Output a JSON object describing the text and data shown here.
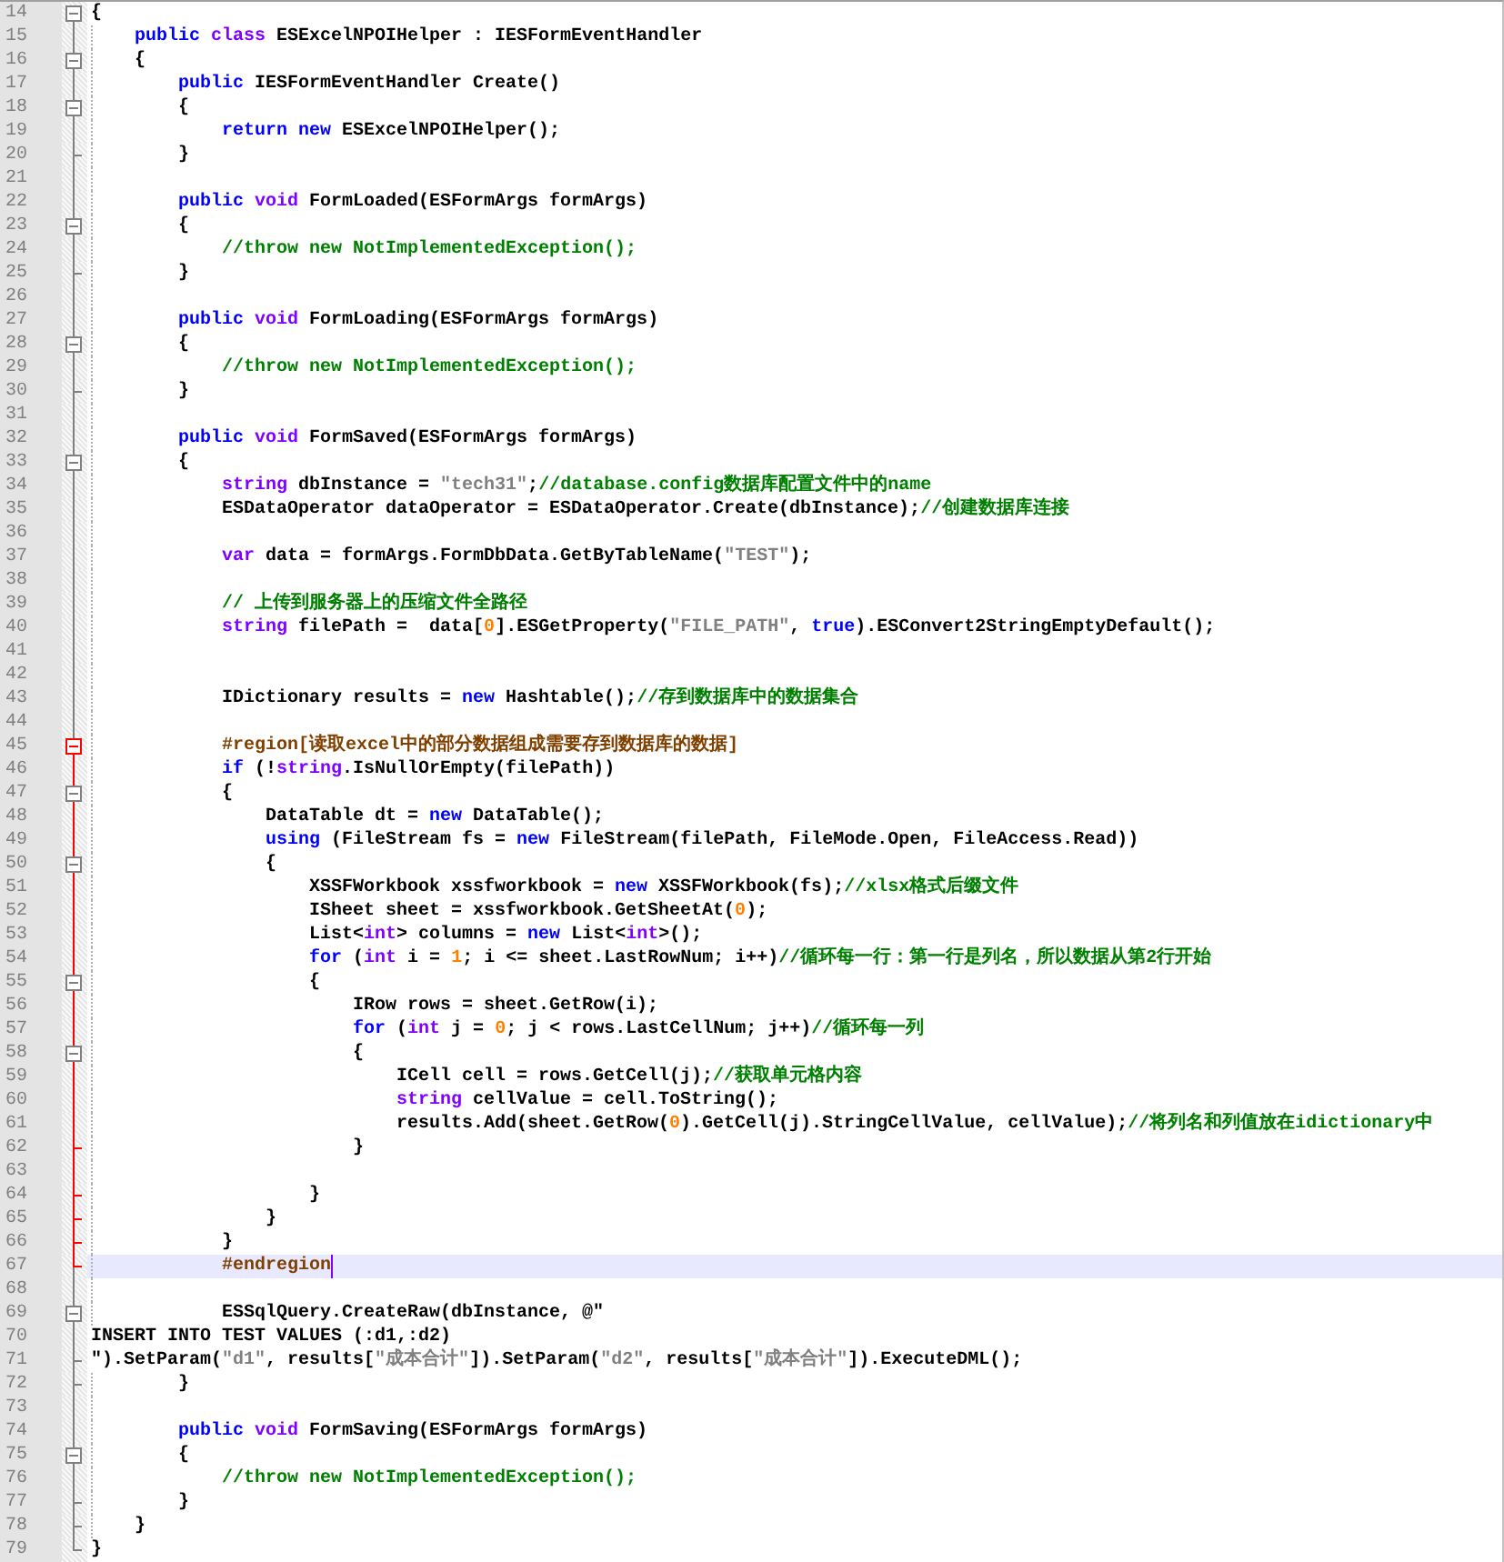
{
  "lines": [
    {
      "number": "14",
      "kind": "code",
      "fold_start": true,
      "fold_end": false,
      "region": false,
      "current": false,
      "segments": [
        {
          "kind": "plain",
          "text": "{"
        }
      ]
    },
    {
      "number": "15",
      "kind": "code",
      "fold_start": false,
      "fold_end": false,
      "region": false,
      "current": false,
      "segments": [
        {
          "kind": "keyword",
          "text": "public "
        },
        {
          "kind": "type",
          "text": "class"
        },
        {
          "kind": "plain",
          "text": " ESExcelNPOIHelper : IESFormEventHandler"
        }
      ]
    },
    {
      "number": "16",
      "kind": "code",
      "fold_start": true,
      "fold_end": false,
      "region": false,
      "current": false,
      "segments": [
        {
          "kind": "plain",
          "text": "{"
        }
      ]
    },
    {
      "number": "17",
      "kind": "code",
      "fold_start": false,
      "fold_end": false,
      "region": false,
      "current": false,
      "segments": [
        {
          "kind": "keyword",
          "text": "public"
        },
        {
          "kind": "plain",
          "text": " IESFormEventHandler Create()"
        }
      ]
    },
    {
      "number": "18",
      "kind": "code",
      "fold_start": true,
      "fold_end": false,
      "region": false,
      "current": false,
      "segments": [
        {
          "kind": "plain",
          "text": "{"
        }
      ]
    },
    {
      "number": "19",
      "kind": "code",
      "fold_start": false,
      "fold_end": false,
      "region": false,
      "current": false,
      "segments": [
        {
          "kind": "keyword",
          "text": "return new"
        },
        {
          "kind": "plain",
          "text": " ESExcelNPOIHelper();"
        }
      ]
    },
    {
      "number": "20",
      "kind": "code",
      "fold_start": false,
      "fold_end": true,
      "region": false,
      "current": false,
      "segments": [
        {
          "kind": "plain",
          "text": "}"
        }
      ]
    },
    {
      "number": "21",
      "kind": "code",
      "fold_start": false,
      "fold_end": false,
      "region": false,
      "current": false
    },
    {
      "number": "22",
      "kind": "code",
      "fold_start": false,
      "fold_end": false,
      "region": false,
      "current": false,
      "segments": [
        {
          "kind": "keyword",
          "text": "public "
        },
        {
          "kind": "type",
          "text": "void"
        },
        {
          "kind": "plain",
          "text": " FormLoaded(ESFormArgs formArgs)"
        }
      ]
    },
    {
      "number": "23",
      "kind": "code",
      "fold_start": true,
      "fold_end": false,
      "region": false,
      "current": false,
      "segments": [
        {
          "kind": "plain",
          "text": "{"
        }
      ]
    },
    {
      "number": "24",
      "kind": "code",
      "fold_start": false,
      "fold_end": false,
      "region": false,
      "current": false,
      "segments": [
        {
          "kind": "comment",
          "text": "//throw new NotImplementedException();"
        }
      ]
    },
    {
      "number": "25",
      "kind": "code",
      "fold_start": false,
      "fold_end": true,
      "region": false,
      "current": false,
      "segments": [
        {
          "kind": "plain",
          "text": "}"
        }
      ]
    },
    {
      "number": "26",
      "kind": "code",
      "fold_start": false,
      "fold_end": false,
      "region": false,
      "current": false
    },
    {
      "number": "27",
      "kind": "code",
      "fold_start": false,
      "fold_end": false,
      "region": false,
      "current": false,
      "segments": [
        {
          "kind": "keyword",
          "text": "public "
        },
        {
          "kind": "type",
          "text": "void"
        },
        {
          "kind": "plain",
          "text": " FormLoading(ESFormArgs formArgs)"
        }
      ]
    },
    {
      "number": "28",
      "kind": "code",
      "fold_start": true,
      "fold_end": false,
      "region": false,
      "current": false,
      "segments": [
        {
          "kind": "plain",
          "text": "{"
        }
      ]
    },
    {
      "number": "29",
      "kind": "code",
      "fold_start": false,
      "fold_end": false,
      "region": false,
      "current": false,
      "segments": [
        {
          "kind": "comment",
          "text": "//throw new NotImplementedException();"
        }
      ]
    },
    {
      "number": "30",
      "kind": "code",
      "fold_start": false,
      "fold_end": true,
      "region": false,
      "current": false,
      "segments": [
        {
          "kind": "plain",
          "text": "}"
        }
      ]
    },
    {
      "number": "31",
      "kind": "code",
      "fold_start": false,
      "fold_end": false,
      "region": false,
      "current": false
    },
    {
      "number": "32",
      "kind": "code",
      "fold_start": false,
      "fold_end": false,
      "region": false,
      "current": false,
      "segments": [
        {
          "kind": "keyword",
          "text": "public "
        },
        {
          "kind": "type",
          "text": "void"
        },
        {
          "kind": "plain",
          "text": " FormSaved(ESFormArgs formArgs)"
        }
      ]
    },
    {
      "number": "33",
      "kind": "code",
      "fold_start": true,
      "fold_end": false,
      "region": false,
      "current": false,
      "segments": [
        {
          "kind": "plain",
          "text": "{"
        }
      ]
    },
    {
      "number": "34",
      "kind": "code",
      "fold_start": false,
      "fold_end": false,
      "region": false,
      "current": false,
      "segments": [
        {
          "kind": "type",
          "text": "string"
        },
        {
          "kind": "plain",
          "text": " dbInstance = "
        },
        {
          "kind": "string",
          "text": "\"tech31\""
        },
        {
          "kind": "plain",
          "text": ";"
        },
        {
          "kind": "comment",
          "text": "//database.config数据库配置文件中的name"
        }
      ]
    },
    {
      "number": "35",
      "kind": "code",
      "fold_start": false,
      "fold_end": false,
      "region": false,
      "current": false,
      "segments": [
        {
          "kind": "plain",
          "text": "ESDataOperator dataOperator = ESDataOperator.Create(dbInstance);"
        },
        {
          "kind": "comment",
          "text": "//创建数据库连接"
        }
      ]
    },
    {
      "number": "36",
      "kind": "code",
      "fold_start": false,
      "fold_end": false,
      "region": false,
      "current": false
    },
    {
      "number": "37",
      "kind": "code",
      "fold_start": false,
      "fold_end": false,
      "region": false,
      "current": false,
      "segments": [
        {
          "kind": "type",
          "text": "var"
        },
        {
          "kind": "plain",
          "text": " data = formArgs.FormDbData.GetByTableName("
        },
        {
          "kind": "string",
          "text": "\"TEST\""
        },
        {
          "kind": "plain",
          "text": ");"
        }
      ]
    },
    {
      "number": "38",
      "kind": "code",
      "fold_start": false,
      "fold_end": false,
      "region": false,
      "current": false
    },
    {
      "number": "39",
      "kind": "code",
      "fold_start": false,
      "fold_end": false,
      "region": false,
      "current": false,
      "segments": [
        {
          "kind": "comment",
          "text": "// 上传到服务器上的压缩文件全路径"
        }
      ]
    },
    {
      "number": "40",
      "kind": "code",
      "fold_start": false,
      "fold_end": false,
      "region": false,
      "current": false,
      "segments": [
        {
          "kind": "type",
          "text": "string"
        },
        {
          "kind": "plain",
          "text": " filePath =  data["
        },
        {
          "kind": "number",
          "text": "0"
        },
        {
          "kind": "plain",
          "text": "].ESGetProperty("
        },
        {
          "kind": "string",
          "text": "\"FILE_PATH\""
        },
        {
          "kind": "plain",
          "text": ", "
        },
        {
          "kind": "keyword",
          "text": "true"
        },
        {
          "kind": "plain",
          "text": ").ESConvert2StringEmptyDefault();"
        }
      ]
    },
    {
      "number": "41",
      "kind": "code",
      "fold_start": false,
      "fold_end": false,
      "region": false,
      "current": false
    },
    {
      "number": "42",
      "kind": "code",
      "fold_start": false,
      "fold_end": false,
      "region": false,
      "current": false
    },
    {
      "number": "43",
      "kind": "code",
      "fold_start": false,
      "fold_end": false,
      "region": false,
      "current": false,
      "segments": [
        {
          "kind": "plain",
          "text": "IDictionary results = "
        },
        {
          "kind": "keyword",
          "text": "new"
        },
        {
          "kind": "plain",
          "text": " Hashtable();"
        },
        {
          "kind": "comment",
          "text": "//存到数据库中的数据集合"
        }
      ]
    },
    {
      "number": "44",
      "kind": "code",
      "fold_start": false,
      "fold_end": false,
      "region": false,
      "current": false
    },
    {
      "number": "45",
      "kind": "code",
      "fold_start": true,
      "fold_end": false,
      "region": true,
      "current": false,
      "segments": [
        {
          "kind": "preprocessor",
          "text": "#region[读取excel中的部分数据组成需要存到数据库的数据]"
        }
      ]
    },
    {
      "number": "46",
      "kind": "code",
      "fold_start": false,
      "fold_end": false,
      "region": true,
      "current": false,
      "segments": [
        {
          "kind": "keyword",
          "text": "if"
        },
        {
          "kind": "plain",
          "text": " (!"
        },
        {
          "kind": "type",
          "text": "string"
        },
        {
          "kind": "plain",
          "text": ".IsNullOrEmpty(filePath))"
        }
      ]
    },
    {
      "number": "47",
      "kind": "code",
      "fold_start": true,
      "fold_end": false,
      "region": true,
      "current": false,
      "segments": [
        {
          "kind": "plain",
          "text": "{"
        }
      ]
    },
    {
      "number": "48",
      "kind": "code",
      "fold_start": false,
      "fold_end": false,
      "region": true,
      "current": false,
      "segments": [
        {
          "kind": "plain",
          "text": "DataTable dt = "
        },
        {
          "kind": "keyword",
          "text": "new"
        },
        {
          "kind": "plain",
          "text": " DataTable();"
        }
      ]
    },
    {
      "number": "49",
      "kind": "code",
      "fold_start": false,
      "fold_end": false,
      "region": true,
      "current": false,
      "segments": [
        {
          "kind": "keyword",
          "text": "using"
        },
        {
          "kind": "plain",
          "text": " (FileStream fs = "
        },
        {
          "kind": "keyword",
          "text": "new"
        },
        {
          "kind": "plain",
          "text": " FileStream(filePath, FileMode.Open, FileAccess.Read))"
        }
      ]
    },
    {
      "number": "50",
      "kind": "code",
      "fold_start": true,
      "fold_end": false,
      "region": true,
      "current": false,
      "segments": [
        {
          "kind": "plain",
          "text": "{"
        }
      ]
    },
    {
      "number": "51",
      "kind": "code",
      "fold_start": false,
      "fold_end": false,
      "region": true,
      "current": false,
      "segments": [
        {
          "kind": "plain",
          "text": "XSSFWorkbook xssfworkbook = "
        },
        {
          "kind": "keyword",
          "text": "new"
        },
        {
          "kind": "plain",
          "text": " XSSFWorkbook(fs);"
        },
        {
          "kind": "comment",
          "text": "//xlsx格式后缀文件"
        }
      ]
    },
    {
      "number": "52",
      "kind": "code",
      "fold_start": false,
      "fold_end": false,
      "region": true,
      "current": false,
      "segments": [
        {
          "kind": "plain",
          "text": "ISheet sheet = xssfworkbook.GetSheetAt("
        },
        {
          "kind": "number",
          "text": "0"
        },
        {
          "kind": "plain",
          "text": ");"
        }
      ]
    },
    {
      "number": "53",
      "kind": "code",
      "fold_start": false,
      "fold_end": false,
      "region": true,
      "current": false,
      "segments": [
        {
          "kind": "plain",
          "text": "List<"
        },
        {
          "kind": "type",
          "text": "int"
        },
        {
          "kind": "plain",
          "text": "> columns = "
        },
        {
          "kind": "keyword",
          "text": "new"
        },
        {
          "kind": "plain",
          "text": " List<"
        },
        {
          "kind": "type",
          "text": "int"
        },
        {
          "kind": "plain",
          "text": ">();"
        }
      ]
    },
    {
      "number": "54",
      "kind": "code",
      "fold_start": false,
      "fold_end": false,
      "region": true,
      "current": false,
      "segments": [
        {
          "kind": "keyword",
          "text": "for"
        },
        {
          "kind": "plain",
          "text": " ("
        },
        {
          "kind": "type",
          "text": "int"
        },
        {
          "kind": "plain",
          "text": " i = "
        },
        {
          "kind": "number",
          "text": "1"
        },
        {
          "kind": "plain",
          "text": "; i <= sheet.LastRowNum; i++)"
        },
        {
          "kind": "comment",
          "text": "//循环每一行：第一行是列名，所以数据从第2行开始"
        }
      ]
    },
    {
      "number": "55",
      "kind": "code",
      "fold_start": true,
      "fold_end": false,
      "region": true,
      "current": false,
      "segments": [
        {
          "kind": "plain",
          "text": "{"
        }
      ]
    },
    {
      "number": "56",
      "kind": "code",
      "fold_start": false,
      "fold_end": false,
      "region": true,
      "current": false,
      "segments": [
        {
          "kind": "plain",
          "text": "IRow rows = sheet.GetRow(i);"
        }
      ]
    },
    {
      "number": "57",
      "kind": "code",
      "fold_start": false,
      "fold_end": false,
      "region": true,
      "current": false,
      "segments": [
        {
          "kind": "keyword",
          "text": "for"
        },
        {
          "kind": "plain",
          "text": " ("
        },
        {
          "kind": "type",
          "text": "int"
        },
        {
          "kind": "plain",
          "text": " j = "
        },
        {
          "kind": "number",
          "text": "0"
        },
        {
          "kind": "plain",
          "text": "; j < rows.LastCellNum; j++)"
        },
        {
          "kind": "comment",
          "text": "//循环每一列"
        }
      ]
    },
    {
      "number": "58",
      "kind": "code",
      "fold_start": true,
      "fold_end": false,
      "region": true,
      "current": false,
      "segments": [
        {
          "kind": "plain",
          "text": "{"
        }
      ]
    },
    {
      "number": "59",
      "kind": "code",
      "fold_start": false,
      "fold_end": false,
      "region": true,
      "current": false,
      "segments": [
        {
          "kind": "plain",
          "text": "ICell cell = rows.GetCell(j);"
        },
        {
          "kind": "comment",
          "text": "//获取单元格内容"
        }
      ]
    },
    {
      "number": "60",
      "kind": "code",
      "fold_start": false,
      "fold_end": false,
      "region": true,
      "current": false,
      "segments": [
        {
          "kind": "type",
          "text": "string"
        },
        {
          "kind": "plain",
          "text": " cellValue = cell.ToString();"
        }
      ]
    },
    {
      "number": "61",
      "kind": "code",
      "fold_start": false,
      "fold_end": false,
      "region": true,
      "current": false,
      "segments": [
        {
          "kind": "plain",
          "text": "results.Add(sheet.GetRow("
        },
        {
          "kind": "number",
          "text": "0"
        },
        {
          "kind": "plain",
          "text": ").GetCell(j).StringCellValue, cellValue);"
        },
        {
          "kind": "comment",
          "text": "//将列名和列值放在idictionary中"
        }
      ]
    },
    {
      "number": "62",
      "kind": "code",
      "fold_start": false,
      "fold_end": true,
      "region": true,
      "current": false,
      "segments": [
        {
          "kind": "plain",
          "text": "}"
        }
      ]
    },
    {
      "number": "63",
      "kind": "code",
      "fold_start": false,
      "fold_end": false,
      "region": true,
      "current": false
    },
    {
      "number": "64",
      "kind": "code",
      "fold_start": false,
      "fold_end": true,
      "region": true,
      "current": false,
      "segments": [
        {
          "kind": "plain",
          "text": "}"
        }
      ]
    },
    {
      "number": "65",
      "kind": "code",
      "fold_start": false,
      "fold_end": true,
      "region": true,
      "current": false,
      "segments": [
        {
          "kind": "plain",
          "text": "}"
        }
      ]
    },
    {
      "number": "66",
      "kind": "code",
      "fold_start": false,
      "fold_end": true,
      "region": true,
      "current": false,
      "segments": [
        {
          "kind": "plain",
          "text": "}"
        }
      ]
    },
    {
      "number": "67",
      "kind": "code",
      "fold_start": false,
      "fold_end": true,
      "region": true,
      "current": true,
      "segments": [
        {
          "kind": "preprocessor",
          "text": "#endregion"
        }
      ]
    },
    {
      "number": "68",
      "kind": "code",
      "fold_start": false,
      "fold_end": false,
      "region": false,
      "current": false
    },
    {
      "number": "69",
      "kind": "code",
      "fold_start": true,
      "fold_end": false,
      "region": false,
      "current": false,
      "segments": [
        {
          "kind": "plain",
          "text": "ESSqlQuery.CreateRaw(dbInstance, @\""
        }
      ]
    },
    {
      "number": "70",
      "kind": "verbatim",
      "fold_start": false,
      "fold_end": false,
      "region": false,
      "current": false,
      "segments": [
        {
          "kind": "plain",
          "text": "INSERT INTO TEST VALUES (:d1,:d2)"
        }
      ]
    },
    {
      "number": "71",
      "kind": "verbatim",
      "fold_start": false,
      "fold_end": true,
      "region": false,
      "current": false,
      "segments": [
        {
          "kind": "plain",
          "text": "\").SetParam("
        },
        {
          "kind": "string",
          "text": "\"d1\""
        },
        {
          "kind": "plain",
          "text": ", results["
        },
        {
          "kind": "string",
          "text": "\"成本合计\""
        },
        {
          "kind": "plain",
          "text": "]).SetParam("
        },
        {
          "kind": "string",
          "text": "\"d2\""
        },
        {
          "kind": "plain",
          "text": ", results["
        },
        {
          "kind": "string",
          "text": "\"成本合计\""
        },
        {
          "kind": "plain",
          "text": "]).ExecuteDML();"
        }
      ]
    },
    {
      "number": "72",
      "kind": "code",
      "fold_start": false,
      "fold_end": true,
      "region": false,
      "current": false,
      "segments": [
        {
          "kind": "plain",
          "text": "}"
        }
      ]
    },
    {
      "number": "73",
      "kind": "code",
      "fold_start": false,
      "fold_end": false,
      "region": false,
      "current": false
    },
    {
      "number": "74",
      "kind": "code",
      "fold_start": false,
      "fold_end": false,
      "region": false,
      "current": false,
      "segments": [
        {
          "kind": "keyword",
          "text": "public "
        },
        {
          "kind": "type",
          "text": "void"
        },
        {
          "kind": "plain",
          "text": " FormSaving(ESFormArgs formArgs)"
        }
      ]
    },
    {
      "number": "75",
      "kind": "code",
      "fold_start": true,
      "fold_end": false,
      "region": false,
      "current": false,
      "segments": [
        {
          "kind": "plain",
          "text": "{"
        }
      ]
    },
    {
      "number": "76",
      "kind": "code",
      "fold_start": false,
      "fold_end": false,
      "region": false,
      "current": false,
      "segments": [
        {
          "kind": "comment",
          "text": "//throw new NotImplementedException();"
        }
      ]
    },
    {
      "number": "77",
      "kind": "code",
      "fold_start": false,
      "fold_end": true,
      "region": false,
      "current": false,
      "segments": [
        {
          "kind": "plain",
          "text": "}"
        }
      ]
    },
    {
      "number": "78",
      "kind": "code",
      "fold_start": false,
      "fold_end": true,
      "region": false,
      "current": false,
      "segments": [
        {
          "kind": "plain",
          "text": "}"
        }
      ]
    },
    {
      "number": "79",
      "kind": "code",
      "fold_start": false,
      "fold_end": true,
      "region": false,
      "current": false,
      "segments": [
        {
          "kind": "plain",
          "text": "}"
        }
      ]
    }
  ]
}
